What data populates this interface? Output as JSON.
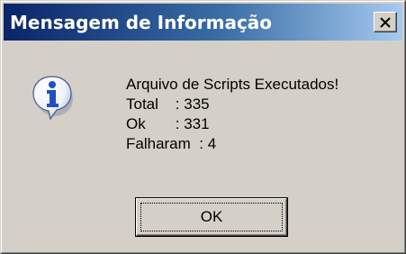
{
  "window": {
    "title": "Mensagem de Informação",
    "close_icon": "close-icon",
    "background": "#d4d0c8",
    "titlebar_gradient": [
      "#0a246a",
      "#a6caf0"
    ]
  },
  "icon": {
    "name": "information-icon",
    "glyph": "i",
    "color": "#1f4fc4"
  },
  "message": {
    "lines": [
      "Arquivo de Scripts Executados!",
      "Total    : 335",
      "Ok       : 331",
      "Falharam  : 4"
    ]
  },
  "buttons": {
    "ok_label": "OK"
  }
}
